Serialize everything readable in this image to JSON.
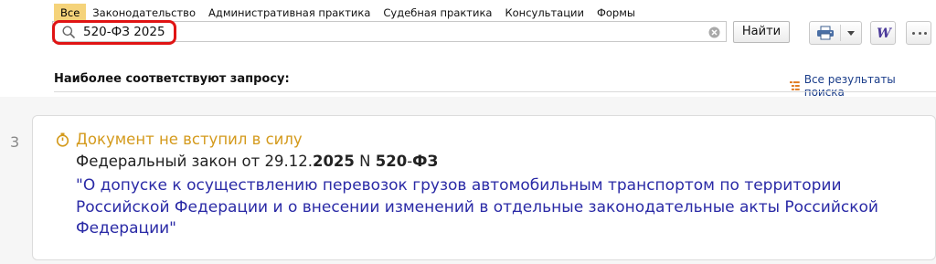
{
  "tabs": [
    {
      "label": "Все",
      "active": true
    },
    {
      "label": "Законодательство",
      "active": false
    },
    {
      "label": "Административная практика",
      "active": false
    },
    {
      "label": "Судебная практика",
      "active": false
    },
    {
      "label": "Консультации",
      "active": false
    },
    {
      "label": "Формы",
      "active": false
    }
  ],
  "search": {
    "value": "520-ФЗ 2025",
    "button_label": "Найти",
    "search_icon": "search-icon",
    "clear_icon": "clear-icon"
  },
  "toolbar": {
    "print_icon": "print-icon",
    "word_icon": "word-icon",
    "more_icon": "more-icon"
  },
  "results_header": {
    "title": "Наиболее соответствуют запросу:",
    "all_results_label": "Все результаты поиска"
  },
  "result": {
    "number": "3",
    "status": "Документ не вступил в силу",
    "meta_prefix": "Федеральный закон от 29.12.",
    "meta_year": "2025",
    "meta_mid": " N ",
    "meta_num": "520",
    "meta_dash": "-",
    "meta_code": "ФЗ",
    "title": "\"О допуске к осуществлению перевозок грузов автомобильным транспортом по территории Российской Федерации и о внесении изменений в отдельные законодательные акты Российской Федерации\""
  },
  "colors": {
    "tab_active": "#f5d37a",
    "highlight": "#e01414",
    "status": "#d49a1c",
    "link": "#2a2aa6"
  }
}
